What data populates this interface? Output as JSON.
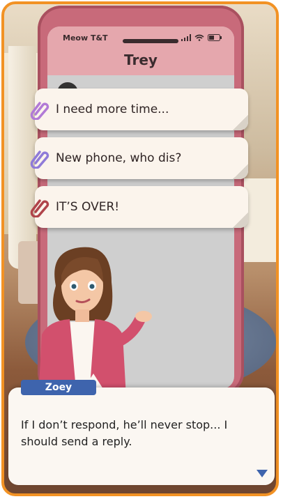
{
  "phone": {
    "carrier": "Meow T&T",
    "contact_name": "Trey"
  },
  "choices": [
    {
      "label": "I need more time...",
      "clip_color": "#b17ad6"
    },
    {
      "label": "New phone, who dis?",
      "clip_color": "#8f7bd8"
    },
    {
      "label": "IT’S OVER!",
      "clip_color": "#b0444a"
    }
  ],
  "dialog": {
    "speaker": "Zoey",
    "text": "If I don’t respond, he’ll never stop... I should send a reply."
  },
  "colors": {
    "frame_accent": "#f29224",
    "phone_case": "#c86a7a",
    "nameplate": "#3e64ad"
  }
}
